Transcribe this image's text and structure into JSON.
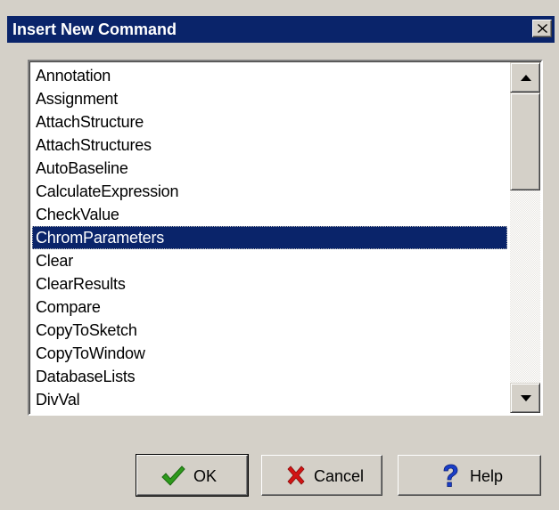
{
  "dialog": {
    "title": "Insert New Command",
    "close_icon": "close-icon"
  },
  "commands": {
    "items": [
      "Annotation",
      "Assignment",
      "AttachStructure",
      "AttachStructures",
      "AutoBaseline",
      "CalculateExpression",
      "CheckValue",
      "ChromParameters",
      "Clear",
      "ClearResults",
      "Compare",
      "CopyToSketch",
      "CopyToWindow",
      "DatabaseLists",
      "DivVal"
    ],
    "selected": "ChromParameters"
  },
  "scrollbar": {
    "up_icon": "arrow-up-icon",
    "down_icon": "arrow-down-icon"
  },
  "buttons": {
    "ok_label": "OK",
    "cancel_label": "Cancel",
    "help_label": "Help",
    "ok_icon": "checkmark-icon",
    "cancel_icon": "x-icon",
    "help_icon": "question-icon"
  },
  "colors": {
    "title_bar": "#0a246a",
    "selection": "#0a246a",
    "face": "#d4d0c8",
    "ok_icon": "#2e9a1c",
    "cancel_icon": "#d21414",
    "help_icon": "#1a3ec8"
  }
}
